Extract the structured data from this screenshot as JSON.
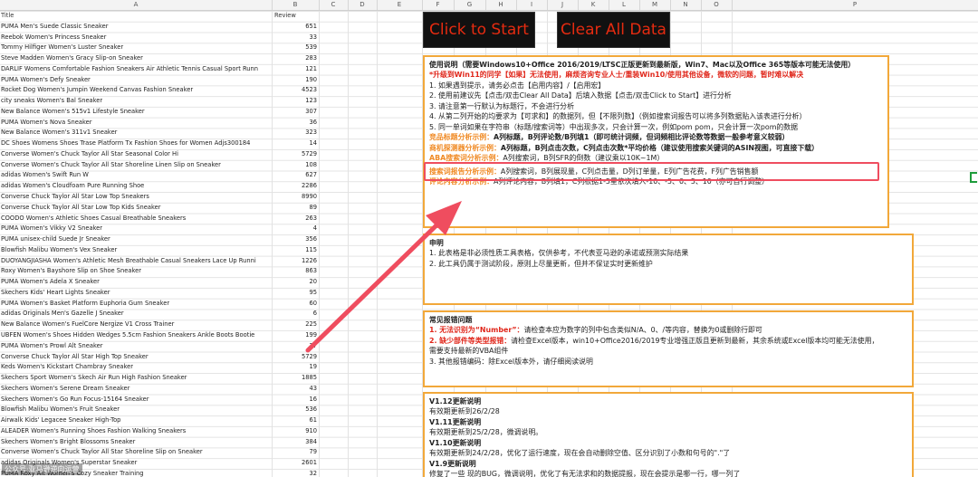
{
  "columns": [
    "A",
    "B",
    "C",
    "D",
    "E",
    "F",
    "G",
    "H",
    "I",
    "J",
    "K",
    "L",
    "M",
    "N",
    "O",
    "P"
  ],
  "header": {
    "title": "Title",
    "review": "Review"
  },
  "rows": [
    {
      "title": "PUMA Men's Suede Classic Sneaker",
      "review": "651"
    },
    {
      "title": "Reebok Women's Princess Sneaker",
      "review": "33"
    },
    {
      "title": "Tommy Hilfiger Women's Luster Sneaker",
      "review": "539"
    },
    {
      "title": "Steve Madden Women's Gracy Slip-on Sneaker",
      "review": "283"
    },
    {
      "title": "DARLIF Womens Comfortable Fashion Sneakers Air Athletic Tennis Casual Sport Runn",
      "review": "121"
    },
    {
      "title": "PUMA Women's Defy Sneaker",
      "review": "190"
    },
    {
      "title": "Rocket Dog Women's Jumpin Weekend Canvas Fashion Sneaker",
      "review": "4523"
    },
    {
      "title": "city sneaks Women's Bal Sneaker",
      "review": "123"
    },
    {
      "title": "New Balance Women's 515v1 Lifestyle Sneaker",
      "review": "307"
    },
    {
      "title": "PUMA Women's Nova Sneaker",
      "review": "36"
    },
    {
      "title": "New Balance Women's 311v1 Sneaker",
      "review": "323"
    },
    {
      "title": "DC Shoes Womens Shoes Trase Platform Tx Fashion Shoes for Women Adjs300184",
      "review": "14"
    },
    {
      "title": "Converse Women's Chuck Taylor All Star Seasonal Color Hi",
      "review": "5729"
    },
    {
      "title": "Converse Women's Chuck Taylor All Star Shoreline Linen Slip on Sneaker",
      "review": "108"
    },
    {
      "title": "adidas Women's Swift Run W",
      "review": "627"
    },
    {
      "title": "adidas Women's Cloudfoam Pure Running Shoe",
      "review": "2286"
    },
    {
      "title": "Converse Chuck Taylor All Star Low Top Sneakers",
      "review": "8990"
    },
    {
      "title": "Converse Chuck Taylor All Star Low Top Kids Sneaker",
      "review": "89"
    },
    {
      "title": "COODO Women's Athletic Shoes Casual Breathable Sneakers",
      "review": "263"
    },
    {
      "title": "PUMA Women's Vikky V2 Sneaker",
      "review": "4"
    },
    {
      "title": "PUMA unisex-child Suede Jr Sneaker",
      "review": "356"
    },
    {
      "title": "Blowfish Malibu Women's Vex Sneaker",
      "review": "115"
    },
    {
      "title": "DUOYANGJIASHA Women's Athletic Mesh Breathable Casual Sneakers Lace Up Runni",
      "review": "1226"
    },
    {
      "title": "Roxy Women's Bayshore Slip on Shoe Sneaker",
      "review": "863"
    },
    {
      "title": "PUMA Women's Adela X Sneaker",
      "review": "20"
    },
    {
      "title": "Skechers Kids' Heart Lights Sneaker",
      "review": "95"
    },
    {
      "title": "PUMA Women's Basket Platform Euphoria Gum Sneaker",
      "review": "60"
    },
    {
      "title": "adidas Originals Men's Gazelle J Sneaker",
      "review": "6"
    },
    {
      "title": "New Balance Women's FuelCore Nergize V1 Cross Trainer",
      "review": "225"
    },
    {
      "title": "UBFEN Women's Shoes Hidden Wedges 5.5cm Fashion Sneakers Ankle Boots Bootie",
      "review": "199"
    },
    {
      "title": "PUMA Women's Prowl Alt Sneaker",
      "review": "27"
    },
    {
      "title": "Converse Chuck Taylor All Star High Top Sneaker",
      "review": "5729"
    },
    {
      "title": "Keds Women's Kickstart Chambray Sneaker",
      "review": "19"
    },
    {
      "title": "Skechers Sport Women's Skech Air Run High Fashion Sneaker",
      "review": "1885"
    },
    {
      "title": "Skechers Women's Serene Dream Sneaker",
      "review": "43"
    },
    {
      "title": "Skechers Women's Go Run Focus-15164 Sneaker",
      "review": "16"
    },
    {
      "title": "Blowfish Malibu Women's Fruit Sneaker",
      "review": "536"
    },
    {
      "title": "Airwalk Kids' Legacee Sneaker High-Top",
      "review": "61"
    },
    {
      "title": "ALEADER Women's Running Shoes Fashion Walking Sneakers",
      "review": "910"
    },
    {
      "title": "Skechers Women's Bright Blossoms Sneaker",
      "review": "384"
    },
    {
      "title": "Converse Women's Chuck Taylor All Star Shoreline Slip on Sneaker",
      "review": "79"
    },
    {
      "title": "adidas Originals Women's Superstar Sneaker",
      "review": "2601"
    },
    {
      "title": "PUMA Roxy Alt Women's Cozy Sneaker Training",
      "review": "32"
    }
  ],
  "buttons": {
    "start": "Click to Start",
    "clear": "Clear All Data"
  },
  "instructions": {
    "l1": "使用说明（需要Windows10+Office 2016/2019/LTSC正版更新到最新版，Win7、Mac以及Office 365等版本可能无法使用）",
    "l2": "*升级到Win11的同学【如果】无法使用，麻烦咨询专业人士/重装Win10/使用其他设备，微软的问题，暂时难以解决",
    "l3": "1. 如果遇到提示，请务必点击【启用内容】/【启用宏】",
    "l4": "2. 使用前建议先【点击/双击Clear All Data】后填入数据【点击/双击Click to Start】进行分析",
    "l5": "3. 请注意第一行默认为标题行，不会进行分析",
    "l6": "4. 从第二列开始的均要求为【可求和】的数据列，但【不限列数】（例如搜索词报告可以将多列数据贴入该表进行分析）",
    "l7": "5. 同一单词如果在字符串（标题/搜索词等）中出现多次，只会计算一次，例如pom pom，只会计算一次pom的数据",
    "l8a": "竞品标题分析示例：",
    "l8b": "A列标题，B列评论数/B列填1（即可统计词频，但词频相比评论数等数据一般参考意义较弱）",
    "l9a": "商机探测器分析示例：",
    "l9b": "A列标题，B列点击次数，C列点击次数*平均价格（建议使用搜索关键词的ASIN视图，可直接下载）",
    "l10a": "ABA搜索词分析示例：",
    "l10b": "A列搜索词，B列SFR的倒数（建议乘以10K~1M）",
    "l11a": "搜索词报告分析示例：",
    "l11b": "A列搜索词，B列展现量，C列点击量，D列订单量，E列广告花费，F列广告销售额",
    "l12a": "评论内容分析示例：",
    "l12b": "A列评论内容，B列填1，C列根据1-5星依次填入-10、-5、0、5、10（亦可自行调整）"
  },
  "statement": {
    "t": "申明",
    "l1": "1. 此表格是非必须性质工具表格，仅供参考，不代表亚马逊的承诺或预测实际结果",
    "l2": "2. 此工具仍属于测试阶段，原则上尽量更新，但并不保证实时更新维护"
  },
  "faq": {
    "t": "常见报错问题",
    "l1a": "1. 无法识别为“Number”：",
    "l1b": "请检查本应为数字的列中包含类似N/A、0、/等内容，替换为0或删除行即可",
    "l2a": "2. 缺少部件等类型报错：",
    "l2b": "请检查Excel版本，win10+Office2016/2019专业增强正版且更新到最新，其余系统或Excel版本均可能无法使用，",
    "l3": "需要支持最新的VBA组件",
    "l4": "3. 其他报错编码：除Excel版本外，请仔细阅读说明"
  },
  "versions": {
    "v1": "V1.12更新说明",
    "d1": "有效期更新到26/2/28",
    "v2": "V1.11更新说明",
    "d2": "有效期更新到25/2/28，微调说明。",
    "v3": "V1.10更新说明",
    "d3": "有效期更新到24/2/28，优化了运行速度，现在会自动删除空值、区分识别了小数和句号的\".\"了",
    "v4": "V1.9更新说明",
    "d4": "修复了一些 现的BUG，微调说明，优化了有无法求和的数据提报，现在会提示是哪一行，哪一列了"
  },
  "watermark": "公众号·亚马逊逆向运营"
}
